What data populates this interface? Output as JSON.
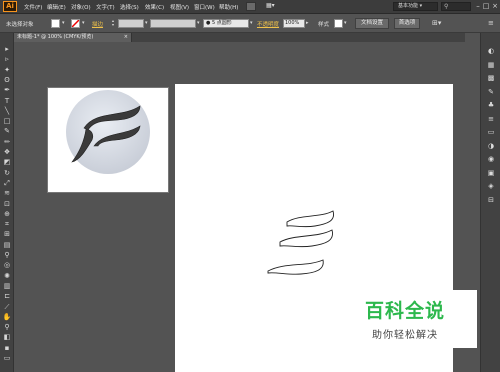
{
  "app": {
    "logo": "Ai",
    "workspace": "基本功能"
  },
  "menu": [
    "文件(F)",
    "编辑(E)",
    "对象(O)",
    "文字(T)",
    "选择(S)",
    "效果(C)",
    "视图(V)",
    "窗口(W)",
    "帮助(H)"
  ],
  "window_buttons": {
    "minimize": "–",
    "restore": "□",
    "close": "×"
  },
  "controlbar": {
    "selection_label": "未选择对象",
    "stroke_label": "描边",
    "brush_value": "5 点圆形",
    "opacity_label": "不透明度",
    "opacity_value": "100%",
    "style_label": "样式",
    "doc_setup_button": "文档设置",
    "preferences_button": "首选项"
  },
  "document_tab": {
    "title": "未标题-1* @ 100% (CMYK/预览)",
    "close": "×"
  },
  "tools": [
    {
      "icon": "selection-tool-icon",
      "glyph": "▸"
    },
    {
      "icon": "direct-selection-tool-icon",
      "glyph": "▹"
    },
    {
      "icon": "magic-wand-tool-icon",
      "glyph": "✦"
    },
    {
      "icon": "lasso-tool-icon",
      "glyph": "ʘ"
    },
    {
      "icon": "pen-tool-icon",
      "glyph": "✒"
    },
    {
      "icon": "type-tool-icon",
      "glyph": "T"
    },
    {
      "icon": "line-tool-icon",
      "glyph": "╲"
    },
    {
      "icon": "rectangle-tool-icon",
      "glyph": "□"
    },
    {
      "icon": "paintbrush-tool-icon",
      "glyph": "✎"
    },
    {
      "icon": "pencil-tool-icon",
      "glyph": "✏"
    },
    {
      "icon": "blob-brush-tool-icon",
      "glyph": "❖"
    },
    {
      "icon": "eraser-tool-icon",
      "glyph": "◩"
    },
    {
      "icon": "rotate-tool-icon",
      "glyph": "↻"
    },
    {
      "icon": "scale-tool-icon",
      "glyph": "⤢"
    },
    {
      "icon": "warp-tool-icon",
      "glyph": "≋"
    },
    {
      "icon": "free-transform-tool-icon",
      "glyph": "⊡"
    },
    {
      "icon": "shape-builder-tool-icon",
      "glyph": "⊕"
    },
    {
      "icon": "perspective-grid-tool-icon",
      "glyph": "⌗"
    },
    {
      "icon": "mesh-tool-icon",
      "glyph": "⊞"
    },
    {
      "icon": "gradient-tool-icon",
      "glyph": "▤"
    },
    {
      "icon": "eyedropper-tool-icon",
      "glyph": "⚲"
    },
    {
      "icon": "blend-tool-icon",
      "glyph": "◎"
    },
    {
      "icon": "symbol-sprayer-tool-icon",
      "glyph": "✺"
    },
    {
      "icon": "column-graph-tool-icon",
      "glyph": "▥"
    },
    {
      "icon": "artboard-tool-icon",
      "glyph": "⊏"
    },
    {
      "icon": "slice-tool-icon",
      "glyph": "⟋"
    },
    {
      "icon": "hand-tool-icon",
      "glyph": "✋"
    },
    {
      "icon": "zoom-tool-icon",
      "glyph": "⚲"
    },
    {
      "icon": "fill-stroke-icon",
      "glyph": "◧"
    },
    {
      "icon": "color-mode-icon",
      "glyph": "▪"
    },
    {
      "icon": "screen-mode-icon",
      "glyph": "▭"
    }
  ],
  "right_panels": [
    {
      "icon": "color-panel-icon",
      "glyph": "◐"
    },
    {
      "icon": "color-guide-panel-icon",
      "glyph": "▦"
    },
    {
      "icon": "swatches-panel-icon",
      "glyph": "▩"
    },
    {
      "icon": "brushes-panel-icon",
      "glyph": "✎"
    },
    {
      "icon": "symbols-panel-icon",
      "glyph": "♣"
    },
    {
      "icon": "stroke-panel-icon",
      "glyph": "≡"
    },
    {
      "icon": "gradient-panel-icon",
      "glyph": "▭"
    },
    {
      "icon": "transparency-panel-icon",
      "glyph": "◑"
    },
    {
      "icon": "appearance-panel-icon",
      "glyph": "◉"
    },
    {
      "icon": "graphic-styles-panel-icon",
      "glyph": "▣"
    },
    {
      "icon": "layers-panel-icon",
      "glyph": "◈"
    },
    {
      "icon": "artboards-panel-icon",
      "glyph": "⊟"
    }
  ],
  "watermark": {
    "title": "百科全说",
    "subtitle": "助你轻松解决"
  }
}
